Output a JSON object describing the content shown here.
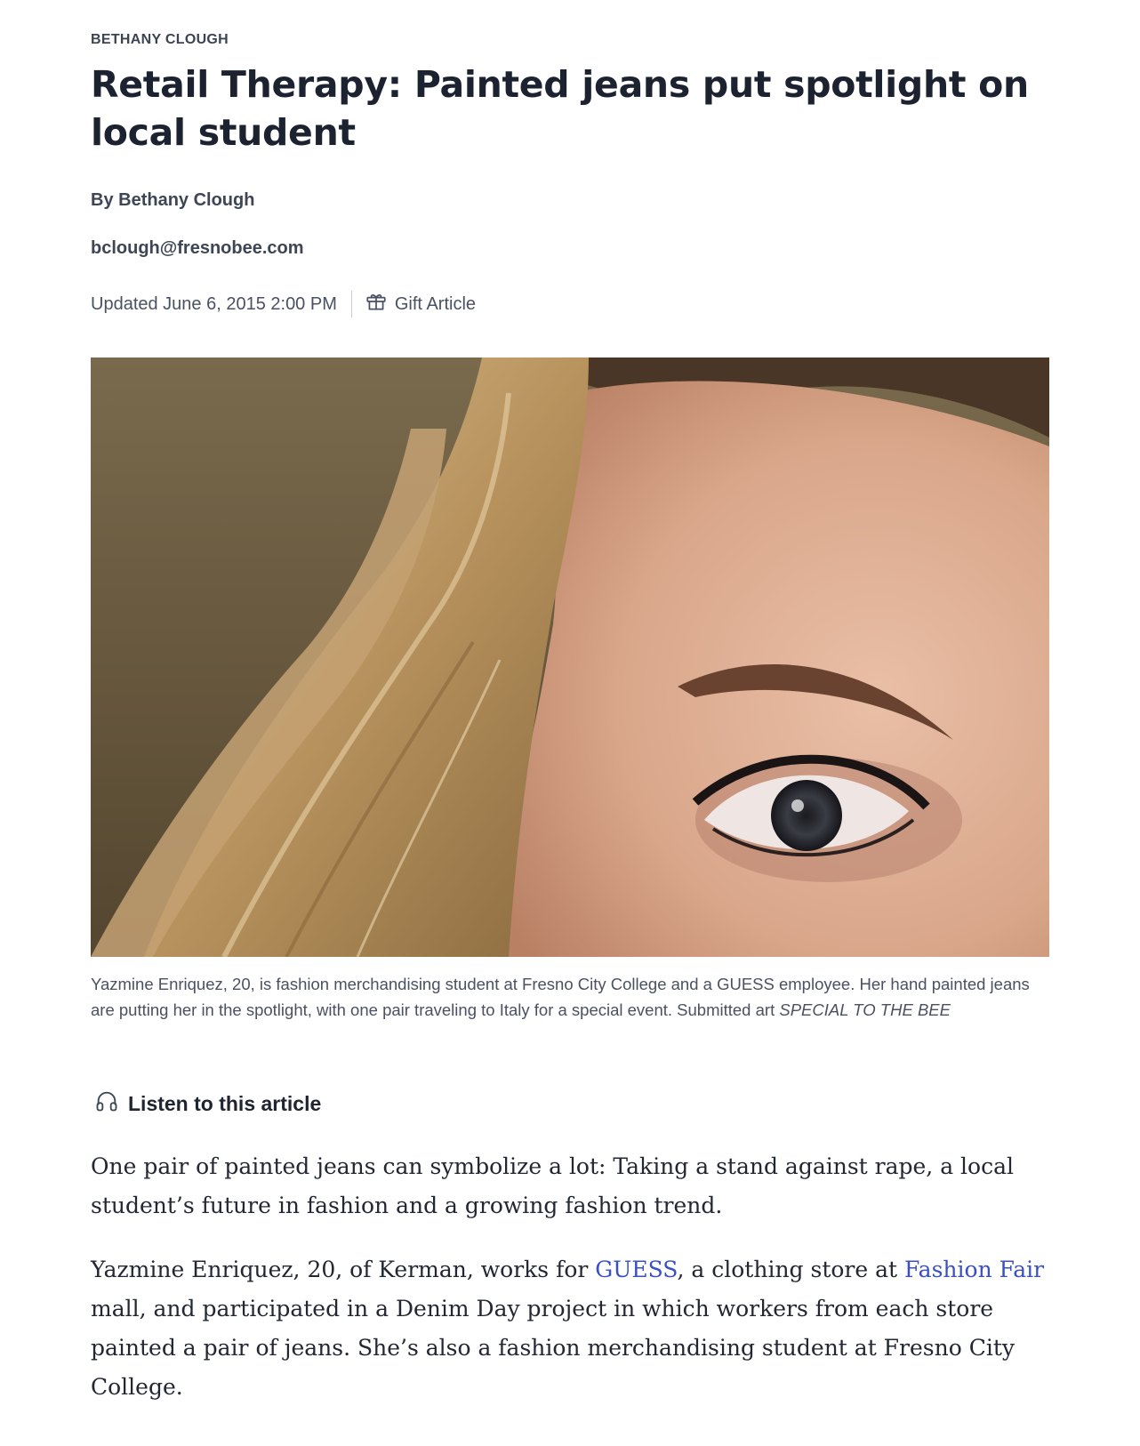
{
  "article": {
    "kicker": "BETHANY CLOUGH",
    "headline": "Retail Therapy: Painted jeans put spotlight on local student",
    "byline_prefix": "By ",
    "author": "Bethany Clough",
    "email": "bclough@fresnobee.com",
    "updated": "Updated June 6, 2015 2:00 PM",
    "gift_label": "Gift Article",
    "caption_text": "Yazmine Enriquez, 20, is fashion merchandising student at Fresno City College and a GUESS employee. Her hand painted jeans are putting her in the spotlight, with one pair traveling to Italy for a special event. Submitted art ",
    "caption_credit": "SPECIAL TO THE BEE",
    "listen_label": "Listen to this article",
    "paragraph1": "One pair of painted jeans can symbolize a lot: Taking a stand against rape, a local student’s future in fashion and a growing fashion trend.",
    "p2_a": "Yazmine Enriquez, 20, of Kerman, works for ",
    "p2_link1": "GUESS",
    "p2_b": ", a clothing store at ",
    "p2_link2": "Fashion Fair",
    "p2_c": " mall, and participated in a Denim Day project in which workers from each store painted a pair of jeans. She’s also a fashion merchandising student at Fresno City College."
  },
  "icons": {
    "gift": "gift-icon",
    "listen": "headphones-icon"
  },
  "colors": {
    "link": "#3a4fc7",
    "text": "#1f2430",
    "meta": "#4a5162"
  }
}
